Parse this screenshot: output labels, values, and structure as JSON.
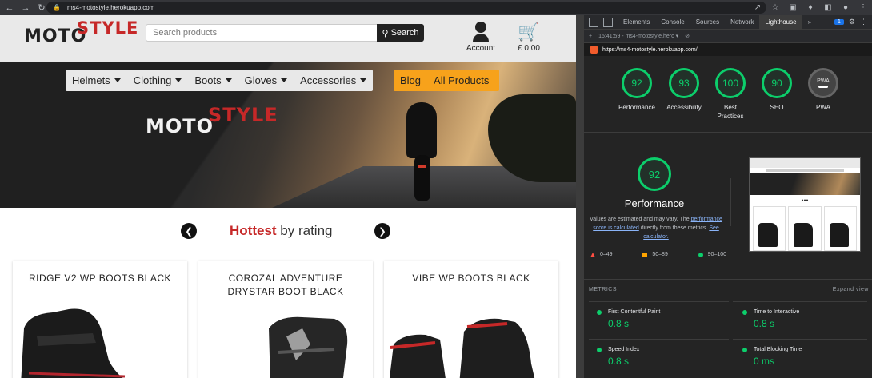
{
  "browser": {
    "url": "ms4-motostyle.herokuapp.com",
    "nav": [
      "back-icon",
      "forward-icon",
      "reload-icon"
    ]
  },
  "site": {
    "logo": {
      "part1": "MOTO",
      "part2": "STYLE"
    },
    "search": {
      "placeholder": "Search products",
      "button_label": "Search"
    },
    "account_label": "Account",
    "cart_total": "£ 0.00",
    "nav_dark": [
      "Helmets",
      "Clothing",
      "Boots",
      "Gloves",
      "Accessories"
    ],
    "nav_accent": {
      "blog": "Blog",
      "all_products": "All Products"
    },
    "hero_logo": {
      "part1": "MOTO",
      "part2": "STYLE"
    },
    "section": {
      "highlight": "Hottest",
      "rest": " by rating"
    },
    "products": [
      {
        "name": "RIDGE V2 WP BOOTS BLACK"
      },
      {
        "name": "COROZAL ADVENTURE DRYSTAR BOOT BLACK"
      },
      {
        "name": "VIBE WP BOOTS BLACK"
      }
    ],
    "colors": {
      "brand_red": "#c62828",
      "accent": "#f7a21b"
    }
  },
  "devtools": {
    "tabs": [
      "Elements",
      "Console",
      "Sources",
      "Network",
      "Lighthouse"
    ],
    "active_tab": "Lighthouse",
    "issues_count": "1",
    "report_time": "15:41:59 - ms4-motostyle.herc",
    "report_url": "https://ms4-motostyle.herokuapp.com/",
    "scores": [
      {
        "label": "Performance",
        "value": "92"
      },
      {
        "label": "Accessibility",
        "value": "93"
      },
      {
        "label": "Best Practices",
        "value": "100"
      },
      {
        "label": "SEO",
        "value": "90"
      },
      {
        "label": "PWA",
        "value": "PWA"
      }
    ],
    "performance": {
      "score": "92",
      "title": "Performance",
      "desc_1": "Values are estimated and may vary. The ",
      "desc_link": "performance score is calculated",
      "desc_2": " directly from these metrics. ",
      "desc_link2": "See calculator."
    },
    "legend": [
      "0–49",
      "50–89",
      "90–100"
    ],
    "metrics_label": "METRICS",
    "expand_label": "Expand view",
    "metrics": [
      {
        "label": "First Contentful Paint",
        "value": "0.8 s"
      },
      {
        "label": "Time to Interactive",
        "value": "0.8 s"
      },
      {
        "label": "Speed Index",
        "value": "0.8 s"
      },
      {
        "label": "Total Blocking Time",
        "value": "0 ms"
      }
    ],
    "colors": {
      "good": "#0cce6b",
      "average": "#ffa400",
      "poor": "#ff4e42"
    }
  }
}
